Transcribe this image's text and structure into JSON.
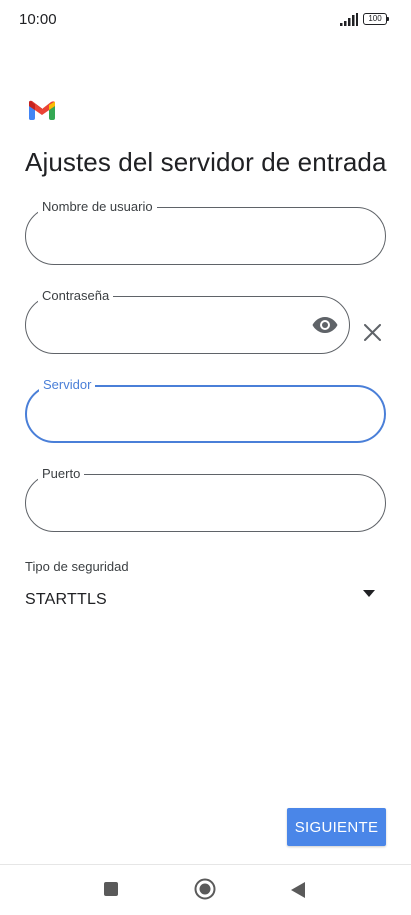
{
  "status_bar": {
    "time": "10:00",
    "battery": "100"
  },
  "app": {
    "logo_icon": "gmail-logo",
    "title": "Ajustes del servidor de entrada"
  },
  "fields": {
    "username": {
      "label": "Nombre de usuario",
      "value": ""
    },
    "password": {
      "label": "Contraseña",
      "value": ""
    },
    "server": {
      "label": "Servidor",
      "value": ""
    },
    "port": {
      "label": "Puerto",
      "value": ""
    }
  },
  "security": {
    "label": "Tipo de seguridad",
    "selected": "STARTTLS"
  },
  "buttons": {
    "next": "SIGUIENTE"
  },
  "colors": {
    "accent": "#4a86e8",
    "focused_border": "#4a7fd8"
  }
}
